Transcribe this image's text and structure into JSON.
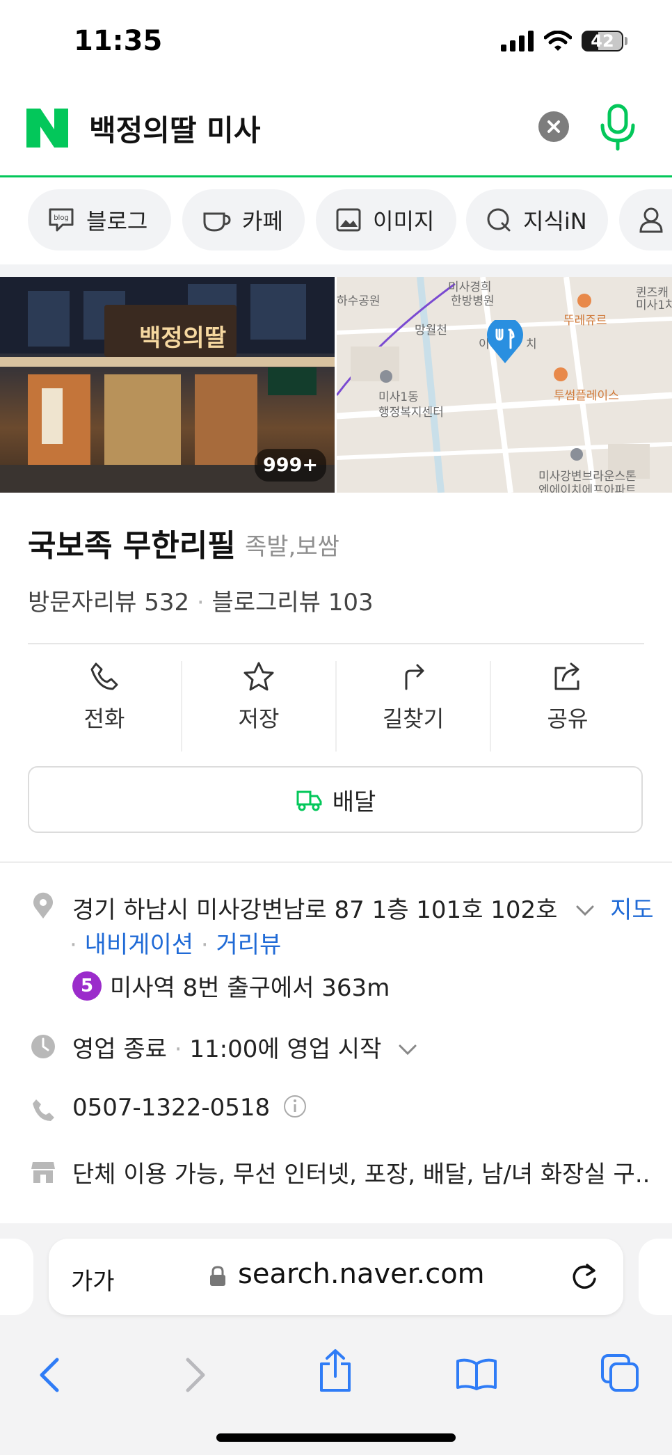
{
  "status_bar": {
    "time": "11:35",
    "battery": "42"
  },
  "search": {
    "query": "백정의딸 미사"
  },
  "chips": [
    {
      "label": "블로그",
      "icon": "blog-icon"
    },
    {
      "label": "카페",
      "icon": "cafe-cup-icon"
    },
    {
      "label": "이미지",
      "icon": "image-icon"
    },
    {
      "label": "지식iN",
      "icon": "q-icon"
    },
    {
      "label": "",
      "icon": "person-icon"
    }
  ],
  "photo": {
    "count": "999+",
    "sign_text": "백정의딸"
  },
  "map": {
    "labels": [
      "미사경희",
      "한방병원",
      "망월천",
      "뚜레쥬르",
      "투썸플레이스",
      "미사1동",
      "행정복지센터",
      "미사강변브라운스톤",
      "엔에이치에프아파트",
      "퀸즈캐",
      "미사1차"
    ],
    "partial_labels": [
      "하수공원",
      "이",
      "치"
    ]
  },
  "place": {
    "name": "국보족 무한리필",
    "category": "족발,보쌈",
    "visitor_reviews": "방문자리뷰 532",
    "blog_reviews": "블로그리뷰 103"
  },
  "actions": [
    {
      "label": "전화",
      "icon": "phone-icon"
    },
    {
      "label": "저장",
      "icon": "star-icon"
    },
    {
      "label": "길찾기",
      "icon": "directions-icon"
    },
    {
      "label": "공유",
      "icon": "share-icon"
    }
  ],
  "delivery": {
    "label": "배달"
  },
  "info": {
    "address": "경기 하남시 미사강변남로 87 1층 101호 102호",
    "map_link": "지도",
    "navigation_link": "내비게이션",
    "street_view_link": "거리뷰",
    "subway_line": "5",
    "subway_text": "미사역 8번 출구에서 363m",
    "hours_status": "영업 종료",
    "hours_next": "11:00에 영업 시작",
    "phone": "0507-1322-0518",
    "facilities": "단체 이용 가능, 무선 인터넷, 포장, 배달, 남/녀 화장실 구..."
  },
  "browser": {
    "text_size": "가가",
    "url": "search.naver.com"
  },
  "colors": {
    "naver_green": "#03c75a",
    "link_blue": "#1f6ad6",
    "map_pin": "#2a8fe0",
    "subway_purple": "#9b2ccb"
  }
}
